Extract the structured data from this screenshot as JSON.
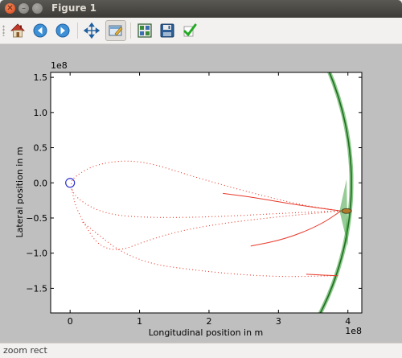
{
  "window": {
    "title": "Figure 1"
  },
  "toolbar": {
    "buttons": [
      {
        "name": "home",
        "icon": "home-icon",
        "active": false
      },
      {
        "name": "back",
        "icon": "back-arrow-icon",
        "active": false
      },
      {
        "name": "forward",
        "icon": "forward-arrow-icon",
        "active": false
      },
      {
        "name": "pan",
        "icon": "pan-arrows-icon",
        "active": false
      },
      {
        "name": "zoom",
        "icon": "zoom-rect-icon",
        "active": true
      },
      {
        "name": "subplots",
        "icon": "subplots-icon",
        "active": false
      },
      {
        "name": "save",
        "icon": "floppy-disk-icon",
        "active": false
      },
      {
        "name": "edit",
        "icon": "checkmark-icon",
        "active": false
      }
    ]
  },
  "status": {
    "text": "zoom rect"
  },
  "colors": {
    "figure_bg": "#bfbfbf",
    "trajectory": "#e8392a",
    "moon_orbit": "#2e9a2e",
    "earth": "#2f2fd0"
  },
  "chart_data": {
    "type": "line",
    "xlabel": "Longitudinal position in m",
    "ylabel": "Lateral position in m",
    "x_offset_text": "1e8",
    "y_offset_text": "1e8",
    "xlim": [
      -0.28,
      4.2
    ],
    "ylim": [
      -1.85,
      1.57
    ],
    "x_ticks": [
      0,
      1,
      2,
      3,
      4
    ],
    "x_tick_labels": [
      "0",
      "1",
      "2",
      "3",
      "4"
    ],
    "y_ticks": [
      -1.5,
      -1.0,
      -0.5,
      0.0,
      0.5,
      1.0,
      1.5
    ],
    "y_tick_labels": [
      "−1.5",
      "−1.0",
      "−0.5",
      "0.0",
      "0.5",
      "1.0",
      "1.5"
    ],
    "grid": false,
    "earth": {
      "x": 0.0,
      "y": 0.0
    },
    "moon_orbit": {
      "radius": 4.05,
      "x_range": [
        3.5,
        4.12
      ]
    },
    "trajectories": [
      {
        "style": "dotted",
        "points": [
          [
            3.9,
            -0.4
          ],
          [
            3.3,
            -0.31
          ],
          [
            2.6,
            -0.14
          ],
          [
            1.8,
            0.08
          ],
          [
            1.0,
            0.33
          ],
          [
            0.4,
            0.28
          ],
          [
            0.06,
            0.09
          ],
          [
            0.0,
            -0.02
          ],
          [
            0.08,
            -0.22
          ],
          [
            0.5,
            -0.45
          ],
          [
            1.2,
            -0.5
          ],
          [
            2.2,
            -0.48
          ],
          [
            3.1,
            -0.43
          ],
          [
            3.9,
            -0.4
          ]
        ]
      },
      {
        "style": "dotted",
        "points": [
          [
            3.9,
            -0.4
          ],
          [
            3.0,
            -0.48
          ],
          [
            2.0,
            -0.6
          ],
          [
            1.3,
            -0.75
          ],
          [
            0.5,
            -1.05
          ],
          [
            0.1,
            -0.42
          ],
          [
            0.02,
            -0.08
          ]
        ]
      },
      {
        "style": "dotted",
        "points": [
          [
            0.18,
            -0.56
          ],
          [
            0.9,
            -1.12
          ],
          [
            2.0,
            -1.27
          ],
          [
            3.0,
            -1.34
          ],
          [
            3.8,
            -1.32
          ]
        ]
      },
      {
        "style": "solid",
        "points": [
          [
            3.9,
            -0.4
          ],
          [
            3.3,
            -0.32
          ],
          [
            2.6,
            -0.2
          ],
          [
            2.2,
            -0.15
          ]
        ]
      },
      {
        "style": "solid",
        "points": [
          [
            3.9,
            -0.4
          ],
          [
            3.6,
            -0.6
          ],
          [
            3.1,
            -0.8
          ],
          [
            2.6,
            -0.9
          ]
        ]
      },
      {
        "style": "solid",
        "points": [
          [
            3.4,
            -1.3
          ],
          [
            3.8,
            -1.32
          ],
          [
            3.86,
            -1.32
          ]
        ]
      }
    ]
  }
}
